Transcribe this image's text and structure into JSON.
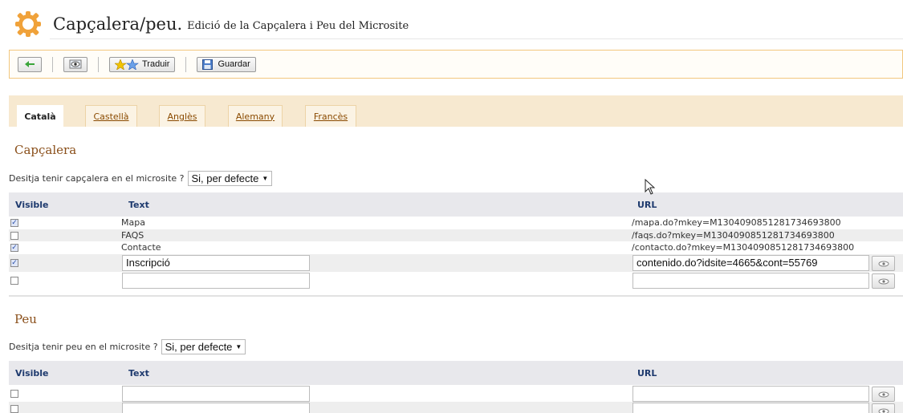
{
  "header": {
    "title": "Capçalera/peu.",
    "subtitle": "Edició de la Capçalera i Peu del Microsite",
    "icon": "gear-icon"
  },
  "toolbar": {
    "back_icon": "back-arrow-icon",
    "preview_icon": "preview-eye-icon",
    "translate_label": "Traduir",
    "translate_icon": "stars-icon",
    "save_label": "Guardar",
    "save_icon": "floppy-disk-icon"
  },
  "tabs": [
    {
      "label": "Català",
      "active": true
    },
    {
      "label": "Castellà",
      "active": false
    },
    {
      "label": "Anglès",
      "active": false
    },
    {
      "label": "Alemany",
      "active": false
    },
    {
      "label": "Francès",
      "active": false
    }
  ],
  "header_section": {
    "title": "Capçalera",
    "question": "Desitja tenir capçalera en el microsite ?",
    "selected": "Si, per defecte",
    "columns": {
      "visible": "Visible",
      "text": "Text",
      "url": "URL"
    },
    "rows": [
      {
        "visible": true,
        "text": "Mapa",
        "url": "/mapa.do?mkey=M1304090851281734693800"
      },
      {
        "visible": false,
        "text": "FAQS",
        "url": "/faqs.do?mkey=M1304090851281734693800"
      },
      {
        "visible": true,
        "text": "Contacte",
        "url": "/contacto.do?mkey=M1304090851281734693800"
      }
    ],
    "edit_rows": [
      {
        "visible": true,
        "text": "Inscripció",
        "url": "contenido.do?idsite=4665&cont=55769"
      },
      {
        "visible": false,
        "text": "",
        "url": ""
      }
    ]
  },
  "footer_section": {
    "title": "Peu",
    "question": "Desitja tenir peu en el microsite ?",
    "selected": "Si, per defecte",
    "columns": {
      "visible": "Visible",
      "text": "Text",
      "url": "URL"
    },
    "edit_rows": [
      {
        "visible": false,
        "text": "",
        "url": ""
      },
      {
        "visible": false,
        "text": "",
        "url": ""
      }
    ]
  },
  "colors": {
    "accent_border": "#f2c77e",
    "tab_band": "#f7e9d0",
    "section_title": "#8a4f1a",
    "header_text": "#1e3a6e"
  }
}
